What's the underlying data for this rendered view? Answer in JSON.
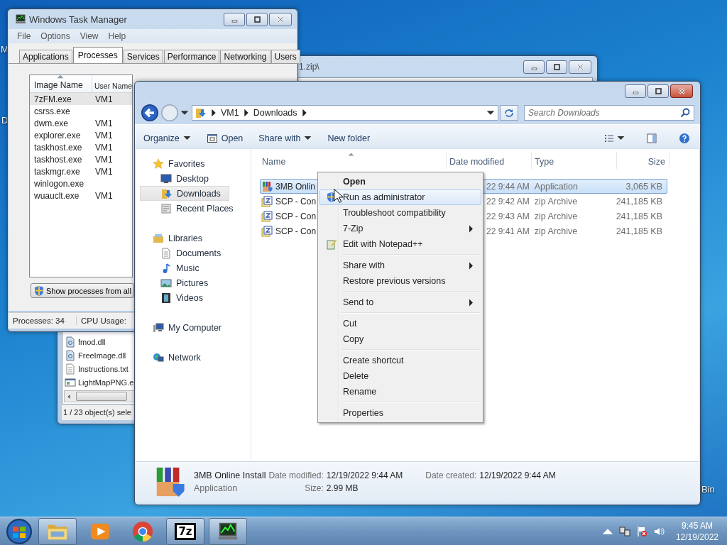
{
  "desktop_icons": [
    {
      "label": "M",
      "kind": "left-top"
    },
    {
      "label": "D",
      "kind": "left-mid"
    },
    {
      "label": "Bin",
      "kind": "right"
    }
  ],
  "back_window": {
    "title": "1.zip\\",
    "files": [
      {
        "name": "fmod.dll",
        "kind": "dll"
      },
      {
        "name": "FreeImage.dll",
        "kind": "dll"
      },
      {
        "name": "Instructions.txt",
        "kind": "txt"
      },
      {
        "name": "LightMapPNG.e",
        "kind": "exe"
      }
    ],
    "status": "1 / 23 object(s) sele"
  },
  "task_manager": {
    "title": "Windows Task Manager",
    "menu": [
      "File",
      "Options",
      "View",
      "Help"
    ],
    "tabs": [
      {
        "label": "Applications",
        "selected": false
      },
      {
        "label": "Processes",
        "selected": true
      },
      {
        "label": "Services",
        "selected": false
      },
      {
        "label": "Performance",
        "selected": false
      },
      {
        "label": "Networking",
        "selected": false
      },
      {
        "label": "Users",
        "selected": false
      }
    ],
    "columns": [
      "Image Name",
      "User Name"
    ],
    "rows": [
      {
        "image": "7zFM.exe",
        "user": "VM1",
        "selected": true
      },
      {
        "image": "csrss.exe",
        "selected": false
      },
      {
        "image": "dwm.exe",
        "user": "VM1",
        "selected": false
      },
      {
        "image": "explorer.exe",
        "user": "VM1",
        "selected": false
      },
      {
        "image": "taskhost.exe",
        "user": "VM1",
        "selected": false
      },
      {
        "image": "taskhost.exe",
        "user": "VM1",
        "selected": false
      },
      {
        "image": "taskmgr.exe",
        "user": "VM1",
        "selected": false
      },
      {
        "image": "winlogon.exe",
        "selected": false
      },
      {
        "image": "wuauclt.exe",
        "user": "VM1",
        "selected": false
      }
    ],
    "button": "Show processes from all",
    "status": [
      "Processes: 34",
      "CPU Usage:"
    ]
  },
  "explorer": {
    "breadcrumb": [
      "VM1",
      "Downloads"
    ],
    "search": {
      "placeholder": "Search Downloads"
    },
    "toolbar": [
      {
        "label": "Organize",
        "kind": "menu"
      },
      {
        "label": "Open",
        "kind": "icon"
      },
      {
        "label": "Share with",
        "kind": "menu"
      },
      {
        "label": "New folder",
        "kind": "plain"
      }
    ],
    "nav": [
      {
        "label": "Favorites",
        "kind": "star",
        "selected": false,
        "children": [
          {
            "label": "Desktop",
            "kind": "monitor",
            "selected": false
          },
          {
            "label": "Downloads",
            "kind": "downloads",
            "selected": true
          },
          {
            "label": "Recent Places",
            "kind": "recent",
            "selected": false
          }
        ]
      },
      {
        "label": "Libraries",
        "kind": "libraries",
        "selected": false,
        "children": [
          {
            "label": "Documents",
            "kind": "document",
            "selected": false
          },
          {
            "label": "Music",
            "kind": "music",
            "selected": false
          },
          {
            "label": "Pictures",
            "kind": "picture",
            "selected": false
          },
          {
            "label": "Videos",
            "kind": "film",
            "selected": false
          }
        ]
      },
      {
        "label": "My Computer",
        "kind": "computer",
        "selected": false
      },
      {
        "label": "Network",
        "kind": "network",
        "selected": false
      }
    ],
    "columns": [
      "Name",
      "Date modified",
      "Type",
      "Size"
    ],
    "rows": [
      {
        "name": "3MB Onlin",
        "date": "22 9:44 AM",
        "type": "Application",
        "size": "3,065 KB",
        "kind": "installer",
        "selected": true
      },
      {
        "name": "SCP - Con",
        "date": "22 9:42 AM",
        "type": "zip Archive",
        "size": "241,185 KB",
        "kind": "zip",
        "selected": false
      },
      {
        "name": "SCP - Con",
        "date": "22 9:43 AM",
        "type": "zip Archive",
        "size": "241,185 KB",
        "kind": "zip",
        "selected": false
      },
      {
        "name": "SCP - Con",
        "date": "22 9:41 AM",
        "type": "zip Archive",
        "size": "241,185 KB",
        "kind": "zip",
        "selected": false
      }
    ],
    "details": {
      "name": "3MB Online Install",
      "type": "Application",
      "fields": [
        {
          "label": "Date modified:",
          "value": "12/19/2022 9:44 AM"
        },
        {
          "label": "Size:",
          "value": "2.99 MB"
        },
        {
          "label": "Date created:",
          "value": "12/19/2022 9:44 AM"
        }
      ]
    }
  },
  "context_menu": {
    "groups": [
      [
        {
          "label": "Open",
          "kind": "plain",
          "bold": true,
          "submenu": false,
          "highlighted": false
        },
        {
          "label": "Run as administrator",
          "kind": "shield",
          "bold": false,
          "submenu": false,
          "highlighted": true
        },
        {
          "label": "Troubleshoot compatibility",
          "kind": "plain",
          "bold": false,
          "submenu": false,
          "highlighted": false
        },
        {
          "label": "7-Zip",
          "kind": "plain",
          "bold": false,
          "submenu": true,
          "highlighted": false
        },
        {
          "label": "Edit with Notepad++",
          "kind": "notepad",
          "bold": false,
          "submenu": false,
          "highlighted": false
        }
      ],
      [
        {
          "label": "Share with",
          "kind": "plain",
          "bold": false,
          "submenu": true,
          "highlighted": false
        },
        {
          "label": "Restore previous versions",
          "kind": "plain",
          "bold": false,
          "submenu": false,
          "highlighted": false
        }
      ],
      [
        {
          "label": "Send to",
          "kind": "plain",
          "bold": false,
          "submenu": true,
          "highlighted": false
        }
      ],
      [
        {
          "label": "Cut",
          "kind": "plain",
          "bold": false,
          "submenu": false,
          "highlighted": false
        },
        {
          "label": "Copy",
          "kind": "plain",
          "bold": false,
          "submenu": false,
          "highlighted": false
        }
      ],
      [
        {
          "label": "Create shortcut",
          "kind": "plain",
          "bold": false,
          "submenu": false,
          "highlighted": false
        },
        {
          "label": "Delete",
          "kind": "plain",
          "bold": false,
          "submenu": false,
          "highlighted": false
        },
        {
          "label": "Rename",
          "kind": "plain",
          "bold": false,
          "submenu": false,
          "highlighted": false
        }
      ],
      [
        {
          "label": "Properties",
          "kind": "plain",
          "bold": false,
          "submenu": false,
          "highlighted": false
        }
      ]
    ]
  },
  "taskbar": {
    "items": [
      {
        "kind": "explorer",
        "running": true
      },
      {
        "kind": "media",
        "running": false
      },
      {
        "kind": "chrome",
        "running": false
      },
      {
        "kind": "sevenzip",
        "label": "7z",
        "running": true
      },
      {
        "kind": "taskmgr",
        "running": true
      }
    ],
    "time": "9:45 AM",
    "date": "12/19/2022"
  }
}
